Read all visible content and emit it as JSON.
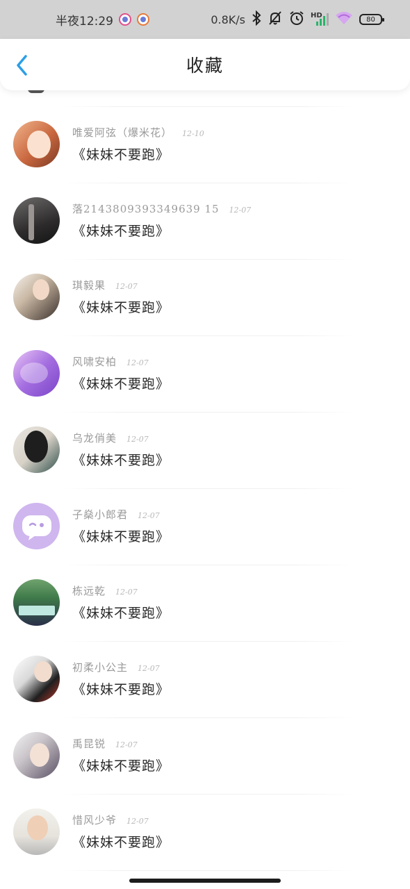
{
  "status_bar": {
    "time": "半夜12:29",
    "network_speed": "0.8K/s",
    "hd_label": "HD",
    "battery": "80",
    "icons": [
      "app-icon",
      "app-icon",
      "bluetooth-icon",
      "mute-bell-icon",
      "alarm-icon",
      "signal-icon",
      "wifi-icon",
      "battery-icon"
    ]
  },
  "header": {
    "title": "收藏",
    "back_icon": "chevron-left-icon",
    "accent_color": "#2b9fe6"
  },
  "favorites": [
    {
      "username": "唯爱阿弦（爆米花）",
      "date": "12-10",
      "title": "《妹妹不要跑》"
    },
    {
      "username": "落2143809393349639 15",
      "date": "12-07",
      "title": "《妹妹不要跑》"
    },
    {
      "username": "琪毅果",
      "date": "12-07",
      "title": "《妹妹不要跑》"
    },
    {
      "username": "风啸安柏",
      "date": "12-07",
      "title": "《妹妹不要跑》"
    },
    {
      "username": "乌龙俏美",
      "date": "12-07",
      "title": "《妹妹不要跑》"
    },
    {
      "username": "子燊小郎君",
      "date": "12-07",
      "title": "《妹妹不要跑》"
    },
    {
      "username": "栋远乾",
      "date": "12-07",
      "title": "《妹妹不要跑》"
    },
    {
      "username": "初柔小公主",
      "date": "12-07",
      "title": "《妹妹不要跑》"
    },
    {
      "username": "禹昆锐",
      "date": "12-07",
      "title": "《妹妹不要跑》"
    },
    {
      "username": "惜风少爷",
      "date": "12-07",
      "title": "《妹妹不要跑》"
    }
  ]
}
